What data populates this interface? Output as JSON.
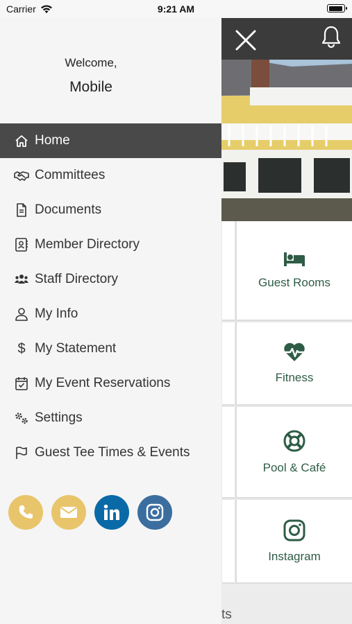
{
  "status_bar": {
    "carrier": "Carrier",
    "time": "9:21 AM"
  },
  "drawer": {
    "welcome": "Welcome,",
    "user_name": "Mobile",
    "menu": [
      {
        "label": "Home",
        "icon": "home-icon",
        "active": true
      },
      {
        "label": "Committees",
        "icon": "handshake-icon"
      },
      {
        "label": "Documents",
        "icon": "document-icon"
      },
      {
        "label": "Member Directory",
        "icon": "member-directory-icon"
      },
      {
        "label": "Staff Directory",
        "icon": "staff-directory-icon"
      },
      {
        "label": "My Info",
        "icon": "user-icon"
      },
      {
        "label": "My Statement",
        "icon": "dollar-icon"
      },
      {
        "label": "My Event Reservations",
        "icon": "calendar-check-icon"
      },
      {
        "label": "Settings",
        "icon": "gears-icon"
      },
      {
        "label": "Guest Tee Times & Events",
        "icon": "flag-icon"
      }
    ],
    "socials": [
      {
        "icon": "phone-icon",
        "color": "#e8c56a"
      },
      {
        "icon": "email-icon",
        "color": "#e8c56a"
      },
      {
        "icon": "linkedin-icon",
        "color": "#0a6aa8"
      },
      {
        "icon": "instagram-icon",
        "color": "#3b6e9f"
      }
    ]
  },
  "background": {
    "tiles": [
      {
        "label": "Guest Rooms",
        "icon": "bed-icon"
      },
      {
        "label": "Fitness",
        "icon": "heartbeat-icon"
      },
      {
        "label": "Pool & Café",
        "icon": "life-ring-icon"
      },
      {
        "label": "Instagram",
        "icon": "instagram-icon"
      }
    ],
    "bottom_partial_text": "ts",
    "accent_color": "#2f5c46"
  }
}
